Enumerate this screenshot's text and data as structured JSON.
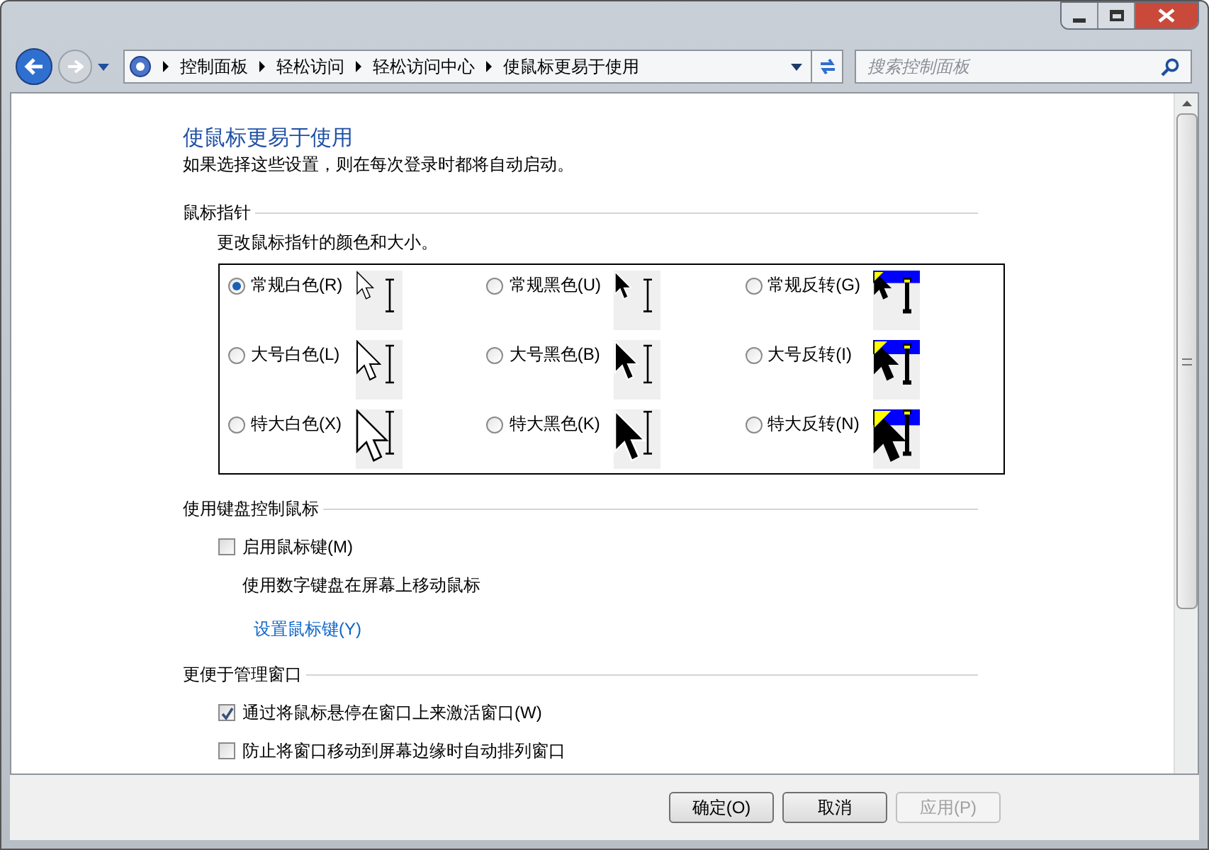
{
  "address_bar": {
    "breadcrumbs": [
      "控制面板",
      "轻松访问",
      "轻松访问中心",
      "使鼠标更易于使用"
    ],
    "search": {
      "placeholder": "搜索控制面板"
    }
  },
  "page": {
    "title": "使鼠标更易于使用",
    "subtitle": "如果选择这些设置，则在每次登录时都将自动启动。"
  },
  "sections": [
    {
      "kind": "pointers",
      "heading": "鼠标指针",
      "description": "更改鼠标指针的颜色和大小。",
      "schemes": [
        {
          "label": "常规白色(R)",
          "selected": true,
          "kind": "white"
        },
        {
          "label": "常规黑色(U)",
          "selected": false,
          "kind": "black"
        },
        {
          "label": "常规反转(G)",
          "selected": false,
          "kind": "inverted"
        },
        {
          "label": "大号白色(L)",
          "selected": false,
          "kind": "white"
        },
        {
          "label": "大号黑色(B)",
          "selected": false,
          "kind": "black"
        },
        {
          "label": "大号反转(I)",
          "selected": false,
          "kind": "inverted"
        },
        {
          "label": "特大白色(X)",
          "selected": false,
          "kind": "white"
        },
        {
          "label": "特大黑色(K)",
          "selected": false,
          "kind": "black"
        },
        {
          "label": "特大反转(N)",
          "selected": false,
          "kind": "inverted"
        }
      ]
    },
    {
      "kind": "options",
      "heading": "使用键盘控制鼠标",
      "items": [
        {
          "kind": "checkbox",
          "label": "启用鼠标键(M)",
          "checked": false
        },
        {
          "kind": "note",
          "label": "使用数字键盘在屏幕上移动鼠标"
        },
        {
          "kind": "link",
          "label": "设置鼠标键(Y)"
        }
      ]
    },
    {
      "kind": "options",
      "heading": "更便于管理窗口",
      "items": [
        {
          "kind": "checkbox",
          "label": "通过将鼠标悬停在窗口上来激活窗口(W)",
          "checked": true
        },
        {
          "kind": "checkbox",
          "label": "防止将窗口移动到屏幕边缘时自动排列窗口",
          "checked": false
        }
      ]
    }
  ],
  "buttons": [
    {
      "label": "确定(O)",
      "disabled": false
    },
    {
      "label": "取消",
      "disabled": false
    },
    {
      "label": "应用(P)",
      "disabled": true
    }
  ]
}
